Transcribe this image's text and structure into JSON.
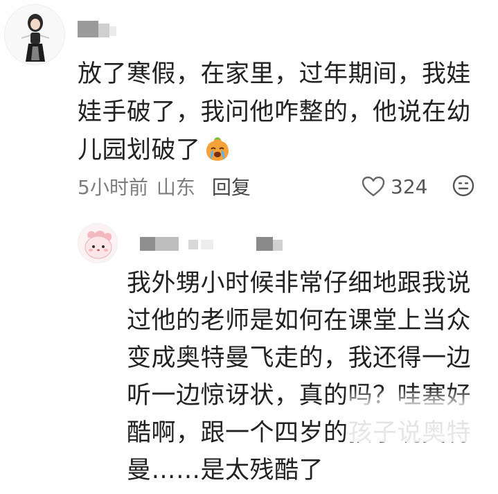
{
  "comment": {
    "text": "放了寒假，在家里，过年期间，我娃娃手破了，我问他咋整的，他说在幼儿园划破了",
    "time": "5小时前",
    "location": "山东",
    "reply_label": "回复",
    "like_count": "324"
  },
  "reply": {
    "text": "我外甥小时候非常仔细地跟我说过他的老师是如何在课堂上当众变成奥特曼飞走的，我还得一边听一边惊讶状，真的吗？哇塞好酷啊，跟一个四岁的孩子说奥特曼……是太残酷了"
  },
  "icons": {
    "crying": "crying-emoji-icon",
    "heart": "heart-icon",
    "reaction": "neutral-face-icon"
  },
  "colors": {
    "meta_text": "#7d7d7d",
    "body_text": "#222222",
    "emoji": "#f4a23a"
  }
}
